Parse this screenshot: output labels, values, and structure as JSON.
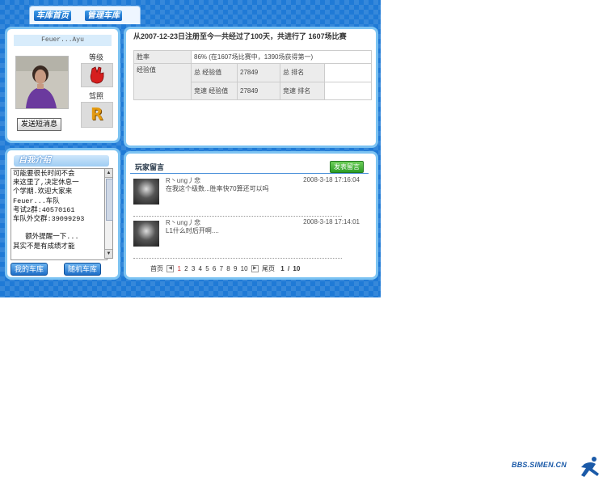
{
  "nav": {
    "tabs": [
      {
        "label": "车库首页"
      },
      {
        "label": "管理车库"
      }
    ]
  },
  "profile": {
    "name": "Feuer...Ayu",
    "level_label": "等级",
    "license_label": "驾照",
    "license_value": "R",
    "send_message_button": "发送短消息"
  },
  "stats": {
    "headline": "从2007-12-23日注册至今一共经过了100天，共进行了 1607场比赛",
    "win_rate_label": "胜率",
    "win_rate_value": "86% (在1607场比赛中，1390场获得第一)",
    "exp_label": "经验值",
    "total_exp_label": "总 经验值",
    "total_exp_value": "27849",
    "total_rank_label": "总 排名",
    "race_exp_label": "竞速 经验值",
    "race_exp_value": "27849",
    "race_rank_label": "竞速 排名"
  },
  "intro": {
    "title": "自我介绍",
    "text": "可能要很长时间不会\n来这里了,决定休息一\n个学期.欢迎大家来\nFeuer...车队\n考试2群:40570161\n车队外交群:39099293\n\n   额外提醒一下...\n其实不是有成绩才能",
    "my_garage_button": "我的车库",
    "random_garage_button": "随机车库"
  },
  "messages": {
    "title": "玩家留言",
    "post_button": "发表留言",
    "items": [
      {
        "author": "R丶ung丿悲",
        "time": "2008-3-18 17:16:04",
        "text": "在我这个级数...胜率快70算还可以吗"
      },
      {
        "author": "R丶ung丿悲",
        "time": "2008-3-18 17:14:01",
        "text": "L1什么时后开啊...."
      }
    ],
    "pager": {
      "first": "首页",
      "pages": [
        "1",
        "2",
        "3",
        "4",
        "5",
        "6",
        "7",
        "8",
        "9",
        "10"
      ],
      "last": "尾页",
      "current": "1",
      "separator": "/",
      "total": "10"
    }
  },
  "watermark": {
    "text": "BBS.SIMEN.CN"
  },
  "colors": {
    "frame": "#1f7ad6",
    "panel_border": "#7cc3f2",
    "accent_red": "#cc2222",
    "post_green": "#2c9e26"
  },
  "icons": {
    "level": "glove-icon",
    "license": "license-r-icon"
  }
}
